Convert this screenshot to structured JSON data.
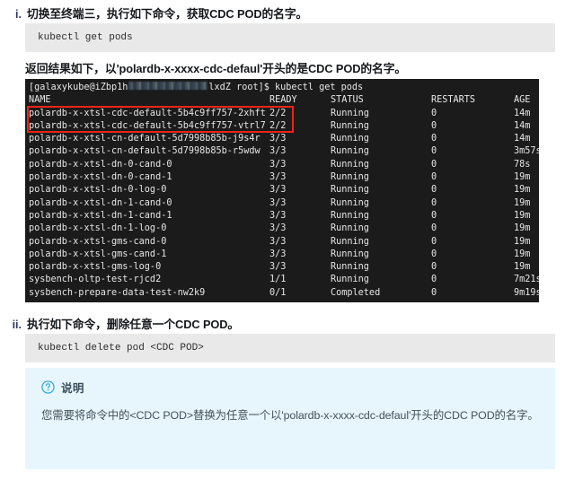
{
  "steps": [
    {
      "marker": "i.",
      "title": "切换至终端三，执行如下命令，获取CDC POD的名字。"
    },
    {
      "marker": "ii.",
      "title": "执行如下命令，删除任意一个CDC POD。"
    }
  ],
  "code_blocks": {
    "get_pods": "kubectl get pods",
    "delete_pod": "kubectl delete pod <CDC POD>"
  },
  "result_paragraph": "返回结果如下，以'polardb-x-xxxx-cdc-defaul'开头的是CDC POD的名字。",
  "terminal": {
    "prompt_user": "[galaxykube@iZbp1h",
    "prompt_tail": "lxdZ root]$ ",
    "prompt_command": "kubectl get pods",
    "columns": [
      "NAME",
      "READY",
      "STATUS",
      "RESTARTS",
      "AGE"
    ],
    "rows": [
      {
        "name": "polardb-x-xtsl-cdc-default-5b4c9ff757-2xhft",
        "ready": "2/2",
        "status": "Running",
        "restarts": "0",
        "age": "14m",
        "highlighted": true
      },
      {
        "name": "polardb-x-xtsl-cdc-default-5b4c9ff757-vtrl7",
        "ready": "2/2",
        "status": "Running",
        "restarts": "0",
        "age": "14m",
        "highlighted": true
      },
      {
        "name": "polardb-x-xtsl-cn-default-5d7998b85b-j9s4r",
        "ready": "3/3",
        "status": "Running",
        "restarts": "0",
        "age": "14m",
        "highlighted": false
      },
      {
        "name": "polardb-x-xtsl-cn-default-5d7998b85b-r5wdw",
        "ready": "3/3",
        "status": "Running",
        "restarts": "0",
        "age": "3m57s",
        "highlighted": false
      },
      {
        "name": "polardb-x-xtsl-dn-0-cand-0",
        "ready": "3/3",
        "status": "Running",
        "restarts": "0",
        "age": "78s",
        "highlighted": false
      },
      {
        "name": "polardb-x-xtsl-dn-0-cand-1",
        "ready": "3/3",
        "status": "Running",
        "restarts": "0",
        "age": "19m",
        "highlighted": false
      },
      {
        "name": "polardb-x-xtsl-dn-0-log-0",
        "ready": "3/3",
        "status": "Running",
        "restarts": "0",
        "age": "19m",
        "highlighted": false
      },
      {
        "name": "polardb-x-xtsl-dn-1-cand-0",
        "ready": "3/3",
        "status": "Running",
        "restarts": "0",
        "age": "19m",
        "highlighted": false
      },
      {
        "name": "polardb-x-xtsl-dn-1-cand-1",
        "ready": "3/3",
        "status": "Running",
        "restarts": "0",
        "age": "19m",
        "highlighted": false
      },
      {
        "name": "polardb-x-xtsl-dn-1-log-0",
        "ready": "3/3",
        "status": "Running",
        "restarts": "0",
        "age": "19m",
        "highlighted": false
      },
      {
        "name": "polardb-x-xtsl-gms-cand-0",
        "ready": "3/3",
        "status": "Running",
        "restarts": "0",
        "age": "19m",
        "highlighted": false
      },
      {
        "name": "polardb-x-xtsl-gms-cand-1",
        "ready": "3/3",
        "status": "Running",
        "restarts": "0",
        "age": "19m",
        "highlighted": false
      },
      {
        "name": "polardb-x-xtsl-gms-log-0",
        "ready": "3/3",
        "status": "Running",
        "restarts": "0",
        "age": "19m",
        "highlighted": false
      },
      {
        "name": "sysbench-oltp-test-rjcd2",
        "ready": "1/1",
        "status": "Running",
        "restarts": "0",
        "age": "7m21s",
        "highlighted": false
      },
      {
        "name": "sysbench-prepare-data-test-nw2k9",
        "ready": "0/1",
        "status": "Completed",
        "restarts": "0",
        "age": "9m19s",
        "highlighted": false
      }
    ]
  },
  "note": {
    "icon": "question-circle-icon",
    "title": "说明",
    "body": "您需要将命令中的<CDC POD>替换为任意一个以'polardb-x-xxxx-cdc-defaul'开头的CDC POD的名字。"
  },
  "colors": {
    "highlight_red": "#ef2418",
    "note_bg": "#e6f6fc",
    "note_accent": "#29a8d8",
    "code_bg": "#e9e9e9",
    "terminal_bg": "#1b1b1b",
    "marker_blue": "#2b3a6b"
  }
}
